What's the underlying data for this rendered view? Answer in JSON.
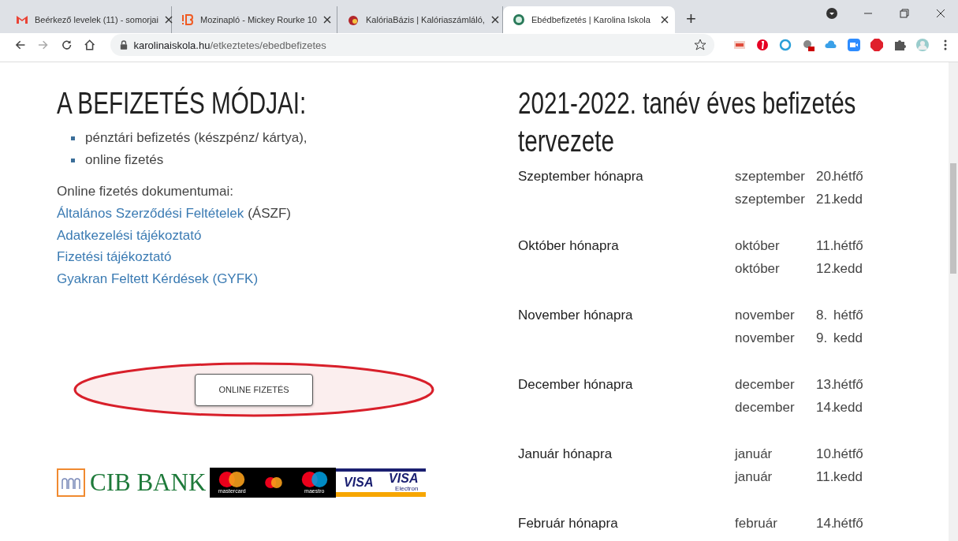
{
  "browser": {
    "tabs": [
      {
        "title": "Beérkező levelek (11) - somorjai",
        "selected": false
      },
      {
        "title": "Mozinapló - Mickey Rourke 10",
        "selected": false
      },
      {
        "title": "KalóriaBázis | Kalóriaszámláló,",
        "selected": false
      },
      {
        "title": "Ebédbefizetés | Karolina Iskola",
        "selected": true
      }
    ],
    "new_tab": "+",
    "url_host": "karolinaiskola.hu",
    "url_path": "/etkeztetes/ebedbefizetes"
  },
  "left": {
    "heading": "A BEFIZETÉS MÓDJAI:",
    "methods": [
      "pénztári befizetés (készpénz/ kártya),",
      "online fizetés"
    ],
    "docs_title": "Online fizetés dokumentumai:",
    "links": [
      {
        "text": "Általános Szerződési Feltételek",
        "suffix": "(ÁSZF)"
      },
      {
        "text": "Adatkezelési tájékoztató"
      },
      {
        "text": "Fizetési tájékoztató"
      },
      {
        "text": "Gyakran Feltett Kérdések (GYFK)"
      }
    ],
    "pay_button": "ONLINE FIZETÉS",
    "logos": {
      "bank": "CIB BANK",
      "mastercard": "mastercard",
      "maestro": "maestro",
      "visa": "VISA",
      "visa_electron": "VISA",
      "electron": "Electron"
    }
  },
  "right": {
    "heading": "2021-2022. tanév éves befizetés tervezete",
    "schedule": [
      {
        "label": "Szeptember hónapra",
        "dates": [
          {
            "month": "szeptember",
            "day": "20.",
            "weekday": "hétfő"
          },
          {
            "month": "szeptember",
            "day": "21.",
            "weekday": "kedd"
          }
        ]
      },
      {
        "label": "Október hónapra",
        "dates": [
          {
            "month": "október",
            "day": "11.",
            "weekday": "hétfő"
          },
          {
            "month": "október",
            "day": "12.",
            "weekday": "kedd"
          }
        ]
      },
      {
        "label": "November hónapra",
        "dates": [
          {
            "month": "november",
            "day": "8.",
            "weekday": "hétfő"
          },
          {
            "month": "november",
            "day": "9.",
            "weekday": "kedd"
          }
        ]
      },
      {
        "label": "December hónapra",
        "dates": [
          {
            "month": "december",
            "day": "13.",
            "weekday": "hétfő"
          },
          {
            "month": "december",
            "day": "14.",
            "weekday": "kedd"
          }
        ]
      },
      {
        "label": "Január hónapra",
        "dates": [
          {
            "month": "január",
            "day": "10.",
            "weekday": "hétfő"
          },
          {
            "month": "január",
            "day": "11.",
            "weekday": "kedd"
          }
        ]
      },
      {
        "label": "Február hónapra",
        "dates": [
          {
            "month": "február",
            "day": "14.",
            "weekday": "hétfő"
          }
        ]
      }
    ]
  }
}
